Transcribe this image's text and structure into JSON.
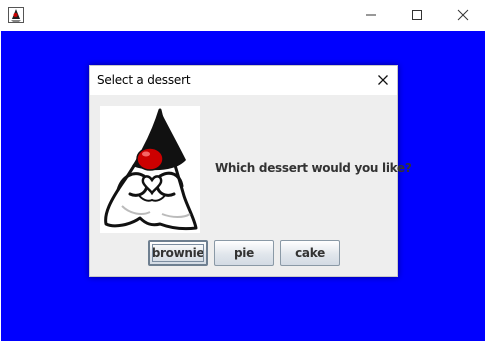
{
  "window": {
    "icon": "java-duke-icon",
    "controls": [
      "minimize-icon",
      "maximize-icon",
      "close-icon"
    ]
  },
  "colors": {
    "content_background": "#0000ff",
    "dialog_background": "#eeeeee",
    "titlebar_background": "#ffffff"
  },
  "dialog": {
    "title": "Select a dessert",
    "message": "Which dessert would you like?",
    "image": "java-duke-mascot",
    "options": [
      "brownie",
      "pie",
      "cake"
    ],
    "focused_option": "brownie"
  }
}
